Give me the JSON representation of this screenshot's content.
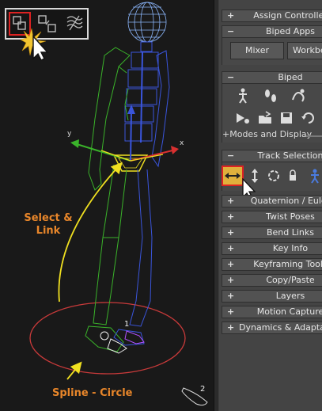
{
  "viewport": {
    "toolbar": {
      "select_link_icon": "select-and-link-icon",
      "unlink_icon": "unlink-selection-icon",
      "bind_icon": "bind-to-space-warp-icon"
    },
    "annotation_select_link": "Select &\nLink",
    "annotation_spline": "Spline - Circle",
    "axis_x": "x",
    "axis_y": "y",
    "footstep_1": "1",
    "footstep_2": "2",
    "colors": {
      "annotation": "#e8862a",
      "circle": "#c83a3a",
      "arrow": "#f0e020",
      "biped_green": "#3ab32a",
      "biped_blue": "#3a55dc",
      "head": "#8ab4f8"
    }
  },
  "panel": {
    "rollouts": {
      "assign_controller": {
        "pm": "+",
        "title": "Assign Controller"
      },
      "biped_apps": {
        "pm": "−",
        "title": "Biped Apps"
      },
      "biped": {
        "pm": "−",
        "title": "Biped"
      },
      "track_selection": {
        "pm": "−",
        "title": "Track Selection"
      },
      "quaternion_euler": {
        "pm": "+",
        "title": "Quaternion / Euler"
      },
      "twist_poses": {
        "pm": "+",
        "title": "Twist Poses"
      },
      "bend_links": {
        "pm": "+",
        "title": "Bend Links"
      },
      "key_info": {
        "pm": "+",
        "title": "Key Info"
      },
      "keyframing_tools": {
        "pm": "+",
        "title": "Keyframing Tools"
      },
      "copy_paste": {
        "pm": "+",
        "title": "Copy/Paste"
      },
      "layers": {
        "pm": "+",
        "title": "Layers"
      },
      "motion_capture": {
        "pm": "+",
        "title": "Motion Capture"
      },
      "dynamics": {
        "pm": "+",
        "title": "Dynamics & Adaptation"
      }
    },
    "biped_apps": {
      "mixer": "Mixer",
      "workbench": "Workbench"
    },
    "biped_buttons": [
      "figure-mode-icon",
      "footstep-mode-icon",
      "motion-flow-icon",
      "mixer-mode-icon",
      "playback-icon",
      "open-file-icon",
      "save-file-icon",
      "load-file-icon"
    ],
    "modes_display": "+Modes and Display",
    "track_buttons": [
      "body-horizontal-icon",
      "body-vertical-icon",
      "body-rotation-icon",
      "lock-cob-keying-icon",
      "symmetrical-icon"
    ]
  }
}
